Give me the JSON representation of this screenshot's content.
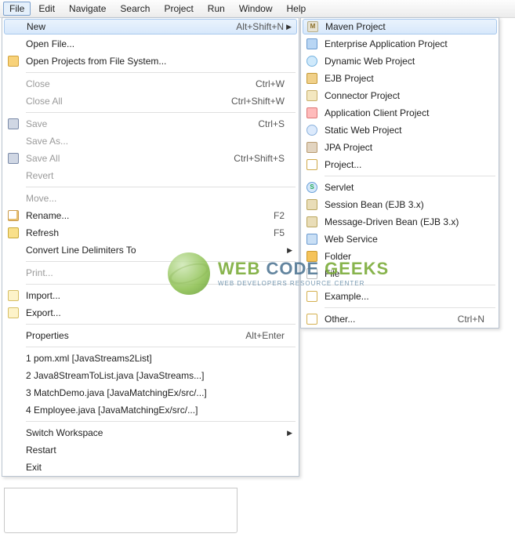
{
  "menubar": [
    "File",
    "Edit",
    "Navigate",
    "Search",
    "Project",
    "Run",
    "Window",
    "Help"
  ],
  "fileMenu": {
    "groups": [
      [
        {
          "label": "New",
          "accel": "Alt+Shift+N",
          "arrow": true,
          "highlight": true,
          "icon": ""
        },
        {
          "label": "Open File...",
          "icon": ""
        },
        {
          "label": "Open Projects from File System...",
          "icon": "folderopen"
        }
      ],
      [
        {
          "label": "Close",
          "accel": "Ctrl+W",
          "disabled": true
        },
        {
          "label": "Close All",
          "accel": "Ctrl+Shift+W",
          "disabled": true
        }
      ],
      [
        {
          "label": "Save",
          "accel": "Ctrl+S",
          "disabled": true,
          "icon": "save"
        },
        {
          "label": "Save As...",
          "disabled": true
        },
        {
          "label": "Save All",
          "accel": "Ctrl+Shift+S",
          "disabled": true,
          "icon": "saveall"
        },
        {
          "label": "Revert",
          "disabled": true
        }
      ],
      [
        {
          "label": "Move...",
          "disabled": true
        },
        {
          "label": "Rename...",
          "accel": "F2",
          "icon": "rename"
        },
        {
          "label": "Refresh",
          "accel": "F5",
          "icon": "refresh"
        },
        {
          "label": "Convert Line Delimiters To",
          "arrow": true
        }
      ],
      [
        {
          "label": "Print...",
          "disabled": true
        }
      ],
      [
        {
          "label": "Import...",
          "icon": "import"
        },
        {
          "label": "Export...",
          "icon": "export"
        }
      ],
      [
        {
          "label": "Properties",
          "accel": "Alt+Enter"
        }
      ],
      [
        {
          "label": "1 pom.xml  [JavaStreams2List]"
        },
        {
          "label": "2 Java8StreamToList.java  [JavaStreams...]"
        },
        {
          "label": "3 MatchDemo.java  [JavaMatchingEx/src/...]"
        },
        {
          "label": "4 Employee.java  [JavaMatchingEx/src/...]"
        }
      ],
      [
        {
          "label": "Switch Workspace",
          "arrow": true
        },
        {
          "label": "Restart"
        },
        {
          "label": "Exit"
        }
      ]
    ]
  },
  "newMenu": {
    "groups": [
      [
        {
          "label": "Maven Project",
          "icon": "mvn",
          "highlight": true
        },
        {
          "label": "Enterprise Application Project",
          "icon": "ear"
        },
        {
          "label": "Dynamic Web Project",
          "icon": "dyn"
        },
        {
          "label": "EJB Project",
          "icon": "ejb"
        },
        {
          "label": "Connector Project",
          "icon": "conn"
        },
        {
          "label": "Application Client Project",
          "icon": "appcli"
        },
        {
          "label": "Static Web Project",
          "icon": "static"
        },
        {
          "label": "JPA Project",
          "icon": "jpa"
        },
        {
          "label": "Project...",
          "icon": "proj"
        }
      ],
      [
        {
          "label": "Servlet",
          "icon": "servlet"
        },
        {
          "label": "Session Bean (EJB 3.x)",
          "icon": "bean"
        },
        {
          "label": "Message-Driven Bean (EJB 3.x)",
          "icon": "bean"
        },
        {
          "label": "Web Service",
          "icon": "ws"
        },
        {
          "label": "Folder",
          "icon": "folder"
        },
        {
          "label": "File",
          "icon": "file"
        }
      ],
      [
        {
          "label": "Example...",
          "icon": "example"
        }
      ],
      [
        {
          "label": "Other...",
          "accel": "Ctrl+N",
          "icon": "other"
        }
      ]
    ]
  },
  "watermark": {
    "main1": "WEB ",
    "main2": "CODE ",
    "main3": "GEEKS",
    "sub": "WEB DEVELOPERS RESOURCE CENTER"
  }
}
